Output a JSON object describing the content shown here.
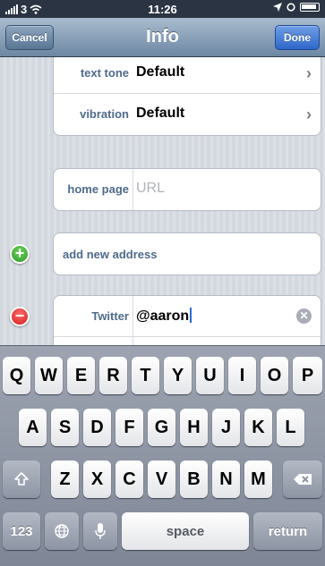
{
  "status_bar": {
    "carrier": "3",
    "time": "11:26",
    "location_icon": "location-arrow-icon",
    "battery_icon": "battery-icon"
  },
  "nav": {
    "title": "Info",
    "cancel_label": "Cancel",
    "done_label": "Done"
  },
  "ringtone_group": [
    {
      "label": "text tone",
      "value": "Default"
    },
    {
      "label": "vibration",
      "value": "Default"
    }
  ],
  "homepage": {
    "label": "home page",
    "placeholder": "URL"
  },
  "address": {
    "label": "add new address"
  },
  "twitter": {
    "label": "Twitter",
    "value": "@aaron"
  },
  "keyboard": {
    "row1": [
      "Q",
      "W",
      "E",
      "R",
      "T",
      "Y",
      "U",
      "I",
      "O",
      "P"
    ],
    "row2": [
      "A",
      "S",
      "D",
      "F",
      "G",
      "H",
      "J",
      "K",
      "L"
    ],
    "row3": [
      "Z",
      "X",
      "C",
      "V",
      "B",
      "N",
      "M"
    ],
    "numbers_label": "123",
    "space_label": "space",
    "return_label": "return"
  },
  "colors": {
    "nav_gradient_top": "#a9bccf",
    "done_blue": "#2f67c9",
    "label_blue": "#4f6a8c",
    "add_green": "#2f9a26",
    "remove_red": "#d11e1e"
  }
}
